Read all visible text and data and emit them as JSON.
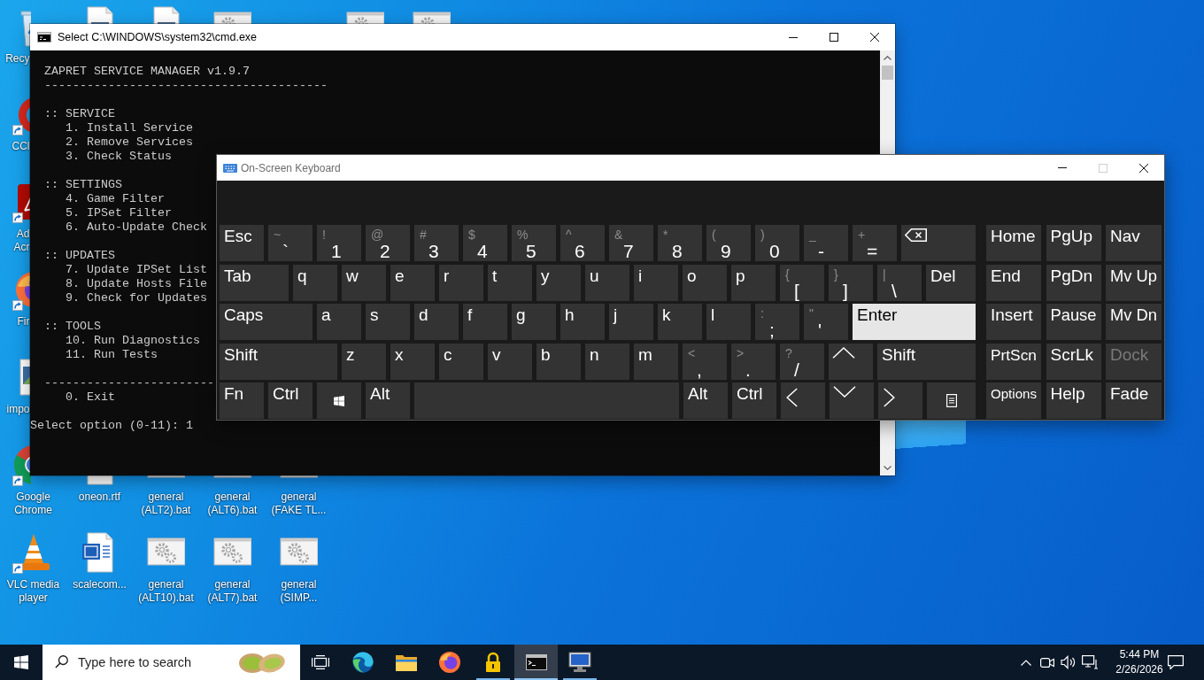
{
  "desktop_icons": [
    {
      "kind": "bin",
      "label": "Recy",
      "shortcut": false
    },
    {
      "kind": "page"
    },
    {
      "kind": "page"
    },
    {
      "kind": "gears"
    },
    {
      "kind": "gears"
    },
    {
      "kind": "gears"
    },
    {
      "kind": "cleaner",
      "label": "CCl",
      "shortcut": true
    },
    {
      "kind": "pdf",
      "label": "Ad Acr",
      "shortcut": true
    },
    {
      "kind": "fox",
      "label": "Fir",
      "shortcut": true
    },
    {
      "kind": "picture",
      "label": "impo",
      "shortcut": false
    },
    {
      "kind": "chrome",
      "label": "Google Chrome",
      "shortcut": true
    },
    {
      "kind": "page",
      "label": "oneon.rtf",
      "shortcut": false
    },
    {
      "kind": "gears",
      "label": "general (ALT2).bat",
      "shortcut": false
    },
    {
      "kind": "gears",
      "label": "general (ALT6).bat",
      "shortcut": false
    },
    {
      "kind": "gears",
      "label": "general (FAKE TL...",
      "shortcut": false
    },
    {
      "kind": "cone",
      "label": "VLC media player",
      "shortcut": true
    },
    {
      "kind": "word",
      "label": "scalecom...",
      "shortcut": false
    },
    {
      "kind": "gears",
      "label": "general (ALT10).bat",
      "shortcut": false
    },
    {
      "kind": "gears",
      "label": "general (ALT7).bat",
      "shortcut": false
    },
    {
      "kind": "gears",
      "label": "general (SIMP...",
      "shortcut": false
    }
  ],
  "cmd_window": {
    "title": "Select C:\\WINDOWS\\system32\\cmd.exe",
    "controls": [
      {
        "kind": "minimize",
        "disabled": false
      },
      {
        "kind": "maximize",
        "disabled": false
      },
      {
        "kind": "close",
        "disabled": false
      }
    ],
    "console": {
      "header": "ZAPRET SERVICE MANAGER v1.9.7",
      "rule": "----------------------------------------",
      "sections": [
        {
          "heading": ":: SERVICE",
          "items": [
            "1. Install Service",
            "2. Remove Services",
            "3. Check Status"
          ]
        },
        {
          "heading": ":: SETTINGS",
          "items": [
            "4. Game Filter",
            "5. IPSet Filter",
            "6. Auto-Update Check"
          ]
        },
        {
          "heading": ":: UPDATES",
          "items": [
            "7. Update IPSet List",
            "8. Update Hosts File",
            "9. Check for Updates"
          ]
        },
        {
          "heading": ":: TOOLS",
          "items": [
            "10. Run Diagnostics",
            "11. Run Tests"
          ]
        }
      ],
      "footer_rule": "------------------------",
      "exit_item": "0. Exit",
      "prompt": "Select option (0-11): 1"
    }
  },
  "osk_window": {
    "title": "On-Screen Keyboard",
    "controls": [
      {
        "kind": "minimize",
        "disabled": false
      },
      {
        "kind": "maximize",
        "disabled": true
      },
      {
        "kind": "close",
        "disabled": false
      }
    ],
    "key_rows": [
      [
        {
          "kind": "text",
          "label": "Esc",
          "pressed": false
        },
        {
          "kind": "dual",
          "shift": "~",
          "label": "`",
          "pressed": false
        },
        {
          "kind": "dual",
          "shift": "!",
          "label": "1",
          "pressed": false
        },
        {
          "kind": "dual",
          "shift": "@",
          "label": "2",
          "pressed": false
        },
        {
          "kind": "dual",
          "shift": "#",
          "label": "3",
          "pressed": false
        },
        {
          "kind": "dual",
          "shift": "$",
          "label": "4",
          "pressed": false
        },
        {
          "kind": "dual",
          "shift": "%",
          "label": "5",
          "pressed": false
        },
        {
          "kind": "dual",
          "shift": "^",
          "label": "6",
          "pressed": false
        },
        {
          "kind": "dual",
          "shift": "&",
          "label": "7",
          "pressed": false
        },
        {
          "kind": "dual",
          "shift": "*",
          "label": "8",
          "pressed": false
        },
        {
          "kind": "dual",
          "shift": "(",
          "label": "9",
          "pressed": false
        },
        {
          "kind": "dual",
          "shift": ")",
          "label": "0",
          "pressed": false
        },
        {
          "kind": "dual",
          "shift": "_",
          "label": "-",
          "pressed": false
        },
        {
          "kind": "dual",
          "shift": "+",
          "label": "=",
          "pressed": false
        },
        {
          "kind": "backspace",
          "pressed": false
        }
      ],
      [
        {
          "kind": "text",
          "label": "Tab",
          "pressed": false
        },
        {
          "kind": "text",
          "label": "q",
          "pressed": false
        },
        {
          "kind": "text",
          "label": "w",
          "pressed": false
        },
        {
          "kind": "text",
          "label": "e",
          "pressed": false
        },
        {
          "kind": "text",
          "label": "r",
          "pressed": false
        },
        {
          "kind": "text",
          "label": "t",
          "pressed": false
        },
        {
          "kind": "text",
          "label": "y",
          "pressed": false
        },
        {
          "kind": "text",
          "label": "u",
          "pressed": false
        },
        {
          "kind": "text",
          "label": "i",
          "pressed": false
        },
        {
          "kind": "text",
          "label": "o",
          "pressed": false
        },
        {
          "kind": "text",
          "label": "p",
          "pressed": false
        },
        {
          "kind": "dual",
          "shift": "{",
          "label": "[",
          "pressed": false
        },
        {
          "kind": "dual",
          "shift": "}",
          "label": "]",
          "pressed": false
        },
        {
          "kind": "dual",
          "shift": "|",
          "label": "\\",
          "pressed": false
        },
        {
          "kind": "text",
          "label": "Del",
          "pressed": false
        }
      ],
      [
        {
          "kind": "text",
          "label": "Caps",
          "pressed": false
        },
        {
          "kind": "text",
          "label": "a",
          "pressed": false
        },
        {
          "kind": "text",
          "label": "s",
          "pressed": false
        },
        {
          "kind": "text",
          "label": "d",
          "pressed": false
        },
        {
          "kind": "text",
          "label": "f",
          "pressed": false
        },
        {
          "kind": "text",
          "label": "g",
          "pressed": false
        },
        {
          "kind": "text",
          "label": "h",
          "pressed": false
        },
        {
          "kind": "text",
          "label": "j",
          "pressed": false
        },
        {
          "kind": "text",
          "label": "k",
          "pressed": false
        },
        {
          "kind": "text",
          "label": "l",
          "pressed": false
        },
        {
          "kind": "dual",
          "shift": ":",
          "label": ";",
          "pressed": false
        },
        {
          "kind": "dual",
          "shift": "\"",
          "label": "'",
          "pressed": false
        },
        {
          "kind": "text",
          "label": "Enter",
          "pressed": true
        }
      ],
      [
        {
          "kind": "text",
          "label": "Shift",
          "pressed": false
        },
        {
          "kind": "text",
          "label": "z",
          "pressed": false
        },
        {
          "kind": "text",
          "label": "x",
          "pressed": false
        },
        {
          "kind": "text",
          "label": "c",
          "pressed": false
        },
        {
          "kind": "text",
          "label": "v",
          "pressed": false
        },
        {
          "kind": "text",
          "label": "b",
          "pressed": false
        },
        {
          "kind": "text",
          "label": "n",
          "pressed": false
        },
        {
          "kind": "text",
          "label": "m",
          "pressed": false
        },
        {
          "kind": "dual",
          "shift": "<",
          "label": ",",
          "pressed": false
        },
        {
          "kind": "dual",
          "shift": ">",
          "label": ".",
          "pressed": false
        },
        {
          "kind": "dual",
          "shift": "?",
          "label": "/",
          "pressed": false
        },
        {
          "kind": "up",
          "pressed": false
        },
        {
          "kind": "text",
          "label": "Shift",
          "pressed": false
        }
      ],
      [
        {
          "kind": "text",
          "label": "Fn",
          "pressed": false
        },
        {
          "kind": "text",
          "label": "Ctrl",
          "pressed": false
        },
        {
          "kind": "windows",
          "pressed": false
        },
        {
          "kind": "text",
          "label": "Alt",
          "pressed": false
        },
        {
          "kind": "space",
          "pressed": false
        },
        {
          "kind": "text",
          "label": "Alt",
          "pressed": false
        },
        {
          "kind": "text",
          "label": "Ctrl",
          "pressed": false
        },
        {
          "kind": "left",
          "pressed": false
        },
        {
          "kind": "down",
          "pressed": false
        },
        {
          "kind": "right",
          "pressed": false
        },
        {
          "kind": "menu",
          "pressed": false
        }
      ]
    ],
    "nav_keys": [
      [
        {
          "label": "Home",
          "disabled": false
        },
        {
          "label": "PgUp",
          "disabled": false
        },
        {
          "label": "Nav",
          "disabled": false
        }
      ],
      [
        {
          "label": "End",
          "disabled": false
        },
        {
          "label": "PgDn",
          "disabled": false
        },
        {
          "label": "Mv Up",
          "disabled": false
        }
      ],
      [
        {
          "label": "Insert",
          "disabled": false
        },
        {
          "label": "Pause",
          "disabled": false
        },
        {
          "label": "Mv Dn",
          "disabled": false
        }
      ],
      [
        {
          "label": "PrtScn",
          "disabled": false
        },
        {
          "label": "ScrLk",
          "disabled": false
        },
        {
          "label": "Dock",
          "disabled": true
        }
      ],
      [
        {
          "label": "Options",
          "disabled": false
        },
        {
          "label": "Help",
          "disabled": false
        },
        {
          "label": "Fade",
          "disabled": false
        }
      ]
    ]
  },
  "taskbar": {
    "search": {
      "placeholder": "Type here to search"
    },
    "apps": [
      {
        "kind": "edge",
        "running": false,
        "selected": false
      },
      {
        "kind": "folder",
        "running": false,
        "selected": false
      },
      {
        "kind": "fox",
        "running": false,
        "selected": false
      },
      {
        "kind": "padlock",
        "running": true,
        "selected": false
      },
      {
        "kind": "console",
        "running": true,
        "selected": true
      },
      {
        "kind": "computer",
        "running": true,
        "selected": false
      }
    ],
    "clock": {
      "time": "5:44 PM",
      "date": "2/26/2026"
    }
  }
}
